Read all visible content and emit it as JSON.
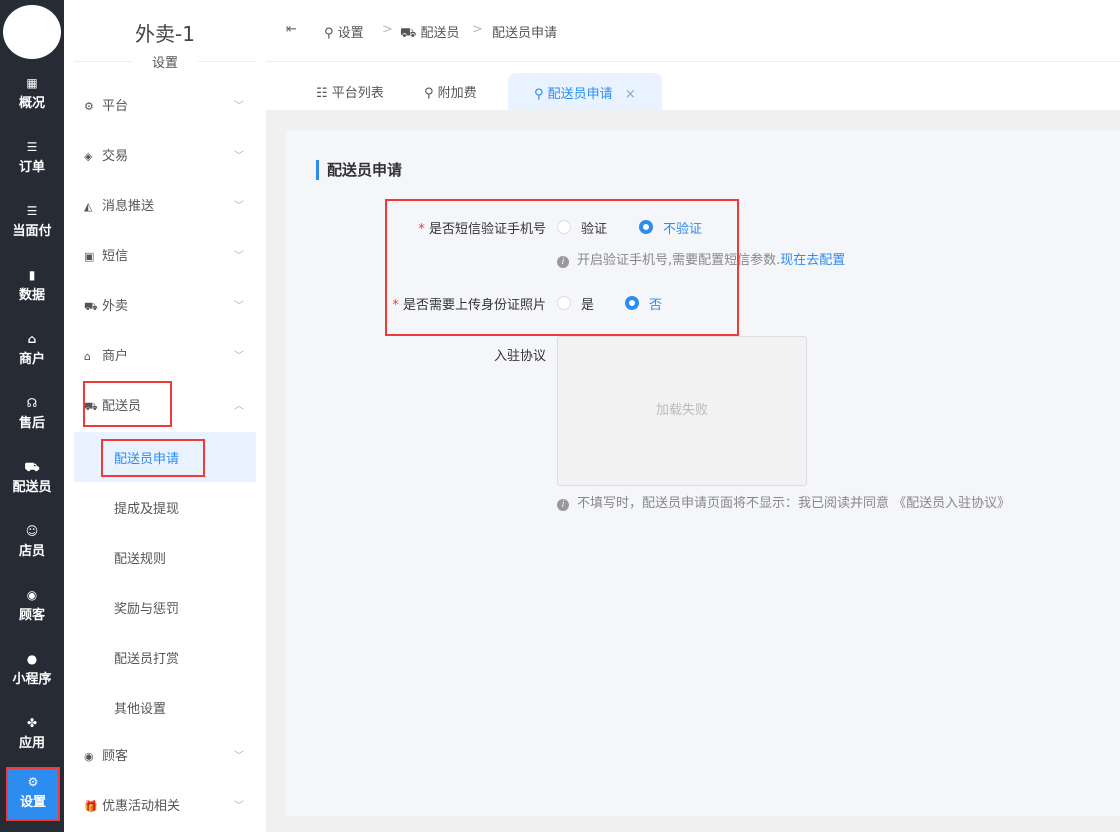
{
  "nav": [
    {
      "label": "概况",
      "icon": "dashboard-icon",
      "glyph": "▦"
    },
    {
      "label": "订单",
      "icon": "list-icon",
      "glyph": "☰"
    },
    {
      "label": "当面付",
      "icon": "list-icon",
      "glyph": "☰"
    },
    {
      "label": "数据",
      "icon": "bar-chart-icon",
      "glyph": "▮"
    },
    {
      "label": "商户",
      "icon": "store-icon",
      "glyph": "⌂"
    },
    {
      "label": "售后",
      "icon": "headset-icon",
      "glyph": "☊"
    },
    {
      "label": "配送员",
      "icon": "scooter-icon",
      "glyph": "⛟"
    },
    {
      "label": "店员",
      "icon": "users-icon",
      "glyph": "☺"
    },
    {
      "label": "顾客",
      "icon": "user-circle-icon",
      "glyph": "◉"
    },
    {
      "label": "小程序",
      "icon": "wechat-icon",
      "glyph": "●"
    },
    {
      "label": "应用",
      "icon": "apps-icon",
      "glyph": "✤"
    },
    {
      "label": "设置",
      "icon": "user-gear-icon",
      "glyph": "⚙"
    }
  ],
  "sub": {
    "title": "外卖-1",
    "subtitle": "设置",
    "items": [
      {
        "label": "平台",
        "icon": "gear-icon",
        "glyph": "⚙"
      },
      {
        "label": "交易",
        "icon": "shield-icon",
        "glyph": "◈"
      },
      {
        "label": "消息推送",
        "icon": "push-icon",
        "glyph": "◭"
      },
      {
        "label": "短信",
        "icon": "sms-icon",
        "glyph": "▣"
      },
      {
        "label": "外卖",
        "icon": "scooter-icon",
        "glyph": "⛟"
      },
      {
        "label": "商户",
        "icon": "store-icon",
        "glyph": "⌂"
      },
      {
        "label": "配送员",
        "icon": "courier-icon",
        "glyph": "⛟"
      }
    ],
    "children": [
      "配送员申请",
      "提成及提现",
      "配送规则",
      "奖励与惩罚",
      "配送员打赏",
      "其他设置"
    ],
    "after": [
      {
        "label": "顾客",
        "icon": "user-circle-icon",
        "glyph": "◉"
      },
      {
        "label": "优惠活动相关",
        "icon": "gift-icon",
        "glyph": "🎁"
      }
    ]
  },
  "breadcrumb": [
    "设置",
    "配送员",
    "配送员申请"
  ],
  "tabs": [
    "平台列表",
    "附加费",
    "配送员申请"
  ],
  "form": {
    "title": "配送员申请",
    "sms_label": "是否短信验证手机号",
    "sms_opts": [
      "验证",
      "不验证"
    ],
    "sms_hint": "开启验证手机号,需要配置短信参数.",
    "sms_link": "现在去配置",
    "id_label": "是否需要上传身份证照片",
    "id_opts": [
      "是",
      "否"
    ],
    "agree_label": "入驻协议",
    "img_failed": "加载失败",
    "agree_hint": "不填写时，配送员申请页面将不显示：我已阅读并同意 《配送员入驻协议》"
  },
  "colors": {
    "accent": "#2d8cf0",
    "nav_bg": "#262b35",
    "highlight": "#f03a3a"
  }
}
